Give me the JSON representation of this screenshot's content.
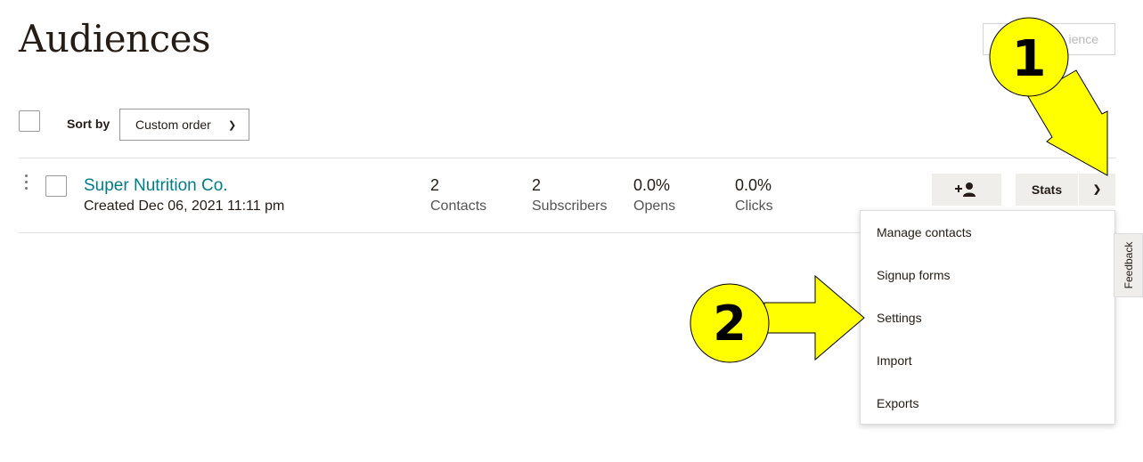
{
  "page": {
    "title": "Audiences",
    "create_button_label": "ience"
  },
  "toolbar": {
    "sort_label": "Sort by",
    "sort_value": "Custom order"
  },
  "audience": {
    "name": "Super Nutrition Co.",
    "created": "Created Dec 06, 2021 11:11 pm",
    "stats": [
      {
        "value": "2",
        "label": "Contacts"
      },
      {
        "value": "2",
        "label": "Subscribers"
      },
      {
        "value": "0.0%",
        "label": "Opens"
      },
      {
        "value": "0.0%",
        "label": "Clicks"
      }
    ],
    "stats_button_label": "Stats"
  },
  "dropdown_menu": {
    "items": [
      "Manage contacts",
      "Signup forms",
      "Settings",
      "Import",
      "Exports"
    ]
  },
  "feedback": {
    "label": "Feedback"
  },
  "annotations": {
    "callout_1": "1",
    "callout_2": "2",
    "color": "#ffff00"
  },
  "colors": {
    "link": "#007c89",
    "text": "#241c15",
    "button_bg": "#efeeea"
  }
}
